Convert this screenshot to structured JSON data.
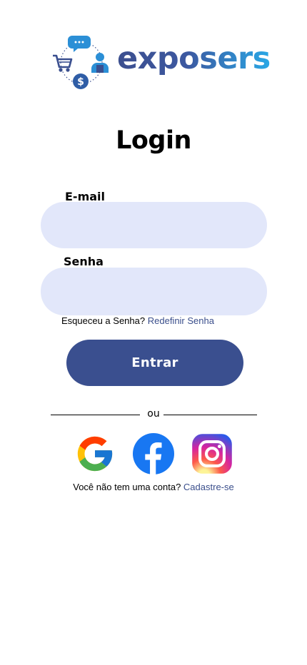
{
  "brand": {
    "name": "exposers",
    "gradient_start": "#3c4f8f",
    "gradient_end": "#29a8e6"
  },
  "page": {
    "title": "Login"
  },
  "form": {
    "email_label": "E-mail",
    "email_value": "",
    "password_label": "Senha",
    "password_value": "",
    "forgot_text": "Esqueceu a Senha?",
    "reset_link": "Redefinir Senha",
    "submit_label": "Entrar",
    "input_bg": "#e2e7fa",
    "accent": "#3a4f8f"
  },
  "divider": {
    "text": "ou"
  },
  "social": [
    {
      "icon": "google-icon"
    },
    {
      "icon": "facebook-icon"
    },
    {
      "icon": "instagram-icon"
    }
  ],
  "signup": {
    "prompt": "Você não tem uma conta?",
    "link": "Cadastre-se"
  }
}
